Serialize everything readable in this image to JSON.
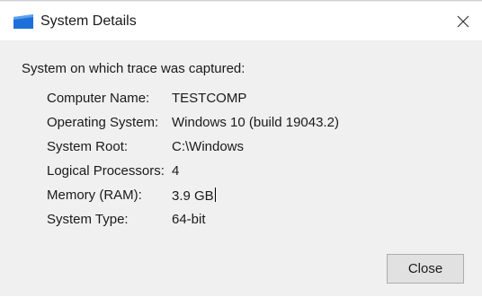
{
  "window": {
    "title": "System Details",
    "icon": "system-details-app-icon",
    "close_icon": "close-icon"
  },
  "intro_text": "System on which trace was captured:",
  "details": [
    {
      "label": "Computer Name:",
      "value": "TESTCOMP"
    },
    {
      "label": "Operating System:",
      "value": "Windows 10 (build 19043.2)"
    },
    {
      "label": "System Root:",
      "value": "C:\\Windows"
    },
    {
      "label": "Logical Processors:",
      "value": "4"
    },
    {
      "label": "Memory (RAM):",
      "value": "3.9 GB"
    },
    {
      "label": "System Type:",
      "value": "64-bit"
    }
  ],
  "buttons": {
    "close_label": "Close"
  },
  "colors": {
    "dialog_bg": "#f0f0f0",
    "titlebar_bg": "#ffffff",
    "icon_blue": "#1e6fd9",
    "button_bg": "#e1e1e1",
    "button_border": "#adadad"
  }
}
